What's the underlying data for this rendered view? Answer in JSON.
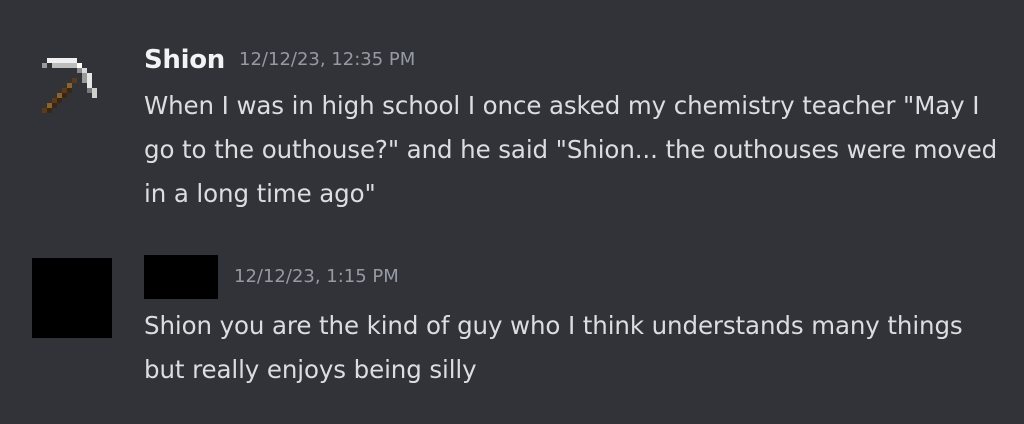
{
  "messages": [
    {
      "username": "Shion",
      "timestamp": "12/12/23, 12:35 PM",
      "avatar_icon": "pickaxe-icon",
      "text": "When I was in high school I once asked my chemistry teacher \"May I go to the outhouse?\" and he said \"Shion... the outhouses were moved in a long time ago\""
    },
    {
      "username": "",
      "timestamp": "12/12/23, 1:15 PM",
      "avatar_icon": "redacted-avatar",
      "text": "Shion you are the kind of guy who I think understands many things but really enjoys being silly"
    }
  ],
  "colors": {
    "background": "#313338",
    "username": "#f2f3f5",
    "timestamp": "#949ba4",
    "message_text": "#dbdee1",
    "redaction": "#000000"
  }
}
